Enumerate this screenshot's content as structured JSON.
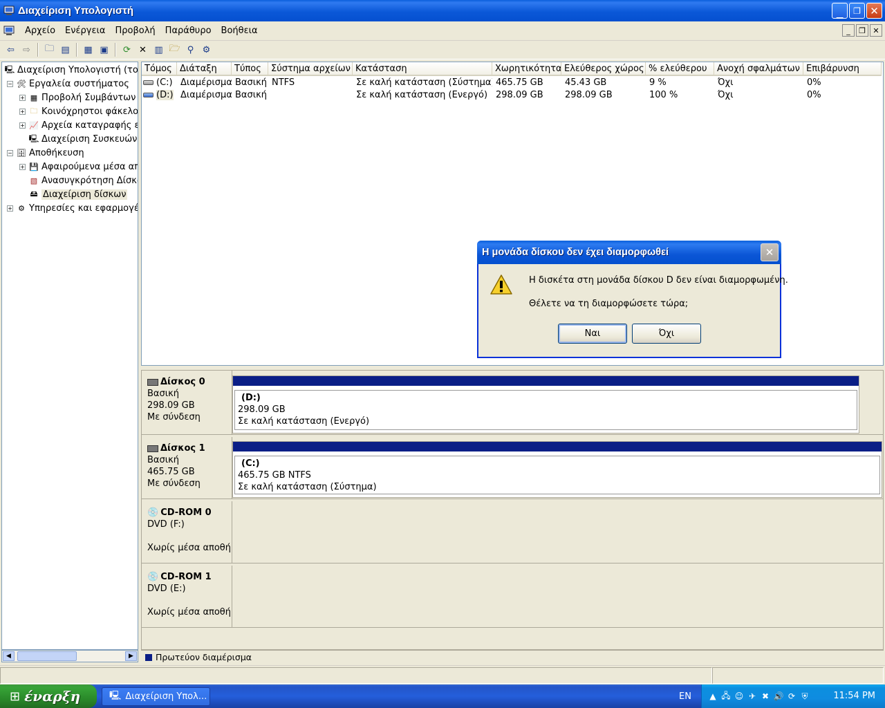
{
  "window": {
    "title": "Διαχείριση Υπολογιστή"
  },
  "menu": [
    "Αρχείο",
    "Ενέργεια",
    "Προβολή",
    "Παράθυρο",
    "Βοήθεια"
  ],
  "toolbar_icons": [
    "back-icon",
    "forward-icon",
    "up-folder-icon",
    "show-hide-tree-icon",
    "properties-icon",
    "help-icon",
    "refresh-icon",
    "delete-icon",
    "properties-2-icon",
    "open-icon",
    "search-icon",
    "settings-icon"
  ],
  "tree": [
    {
      "label": "Διαχείριση Υπολογιστή (τοπικ",
      "level": 0,
      "expander": ""
    },
    {
      "label": "Εργαλεία συστήματος",
      "level": 1,
      "expander": "−"
    },
    {
      "label": "Προβολή Συμβάντων",
      "level": 2,
      "expander": "+"
    },
    {
      "label": "Κοινόχρηστοι φάκελοι",
      "level": 2,
      "expander": "+"
    },
    {
      "label": "Αρχεία καταγραφής επ",
      "level": 2,
      "expander": "+"
    },
    {
      "label": "Διαχείριση Συσκευών",
      "level": 2,
      "expander": ""
    },
    {
      "label": "Αποθήκευση",
      "level": 1,
      "expander": "−"
    },
    {
      "label": "Αφαιρούμενα μέσα απ",
      "level": 2,
      "expander": "+"
    },
    {
      "label": "Ανασυγκρότηση Δίσκω",
      "level": 2,
      "expander": ""
    },
    {
      "label": "Διαχείριση δίσκων",
      "level": 2,
      "expander": "",
      "selected": true
    },
    {
      "label": "Υπηρεσίες και εφαρμογές",
      "level": 1,
      "expander": "+"
    }
  ],
  "volume_table": {
    "columns": [
      "Τόμος",
      "Διάταξη",
      "Τύπος",
      "Σύστημα αρχείων",
      "Κατάσταση",
      "Χωρητικότητα",
      "Ελεύθερος χώρος",
      "% ελεύθερου",
      "Ανοχή σφαλμάτων",
      "Επιβάρυνση"
    ],
    "rows": [
      [
        "(C:)",
        "Διαμέρισμα",
        "Βασική",
        "NTFS",
        "Σε καλή κατάσταση (Σύστημα)",
        "465.75 GB",
        "45.43 GB",
        "9 %",
        "Όχι",
        "0%"
      ],
      [
        "(D:)",
        "Διαμέρισμα",
        "Βασική",
        "",
        "Σε καλή κατάσταση (Ενεργό)",
        "298.09 GB",
        "298.09 GB",
        "100 %",
        "Όχι",
        "0%"
      ]
    ]
  },
  "disks": [
    {
      "name": "Δίσκος 0",
      "type": "Βασική",
      "size": "298.09 GB",
      "status": "Με σύνδεση",
      "partition": {
        "name": "(D:)",
        "size": "298.09 GB",
        "state": "Σε καλή κατάσταση (Ενεργό)"
      }
    },
    {
      "name": "Δίσκος 1",
      "type": "Βασική",
      "size": "465.75 GB",
      "status": "Με σύνδεση",
      "partition": {
        "name": "(C:)",
        "size": "465.75 GB NTFS",
        "state": "Σε καλή κατάσταση (Σύστημα)"
      }
    },
    {
      "name": "CD-ROM 0",
      "type": "DVD (F:)",
      "size": "",
      "status": "Χωρίς μέσα αποθήκ"
    },
    {
      "name": "CD-ROM 1",
      "type": "DVD (E:)",
      "size": "",
      "status": "Χωρίς μέσα αποθήκ"
    }
  ],
  "legend": {
    "label": "Πρωτεύον διαμέρισμα",
    "color": "#0a1e86"
  },
  "dialog": {
    "title": "Η μονάδα δίσκου δεν έχει διαμορφωθεί",
    "line1": "Η δισκέτα στη μονάδα δίσκου D δεν είναι διαμορφωμένη.",
    "line2": "Θέλετε να τη διαμορφώσετε τώρα;",
    "yes": "Ναι",
    "no": "Όχι",
    "icon": "warning-icon"
  },
  "taskbar": {
    "start": "έναρξη",
    "task": "Διαχείριση Υπολ...",
    "lang": "EN",
    "clock": "11:54 PM"
  }
}
